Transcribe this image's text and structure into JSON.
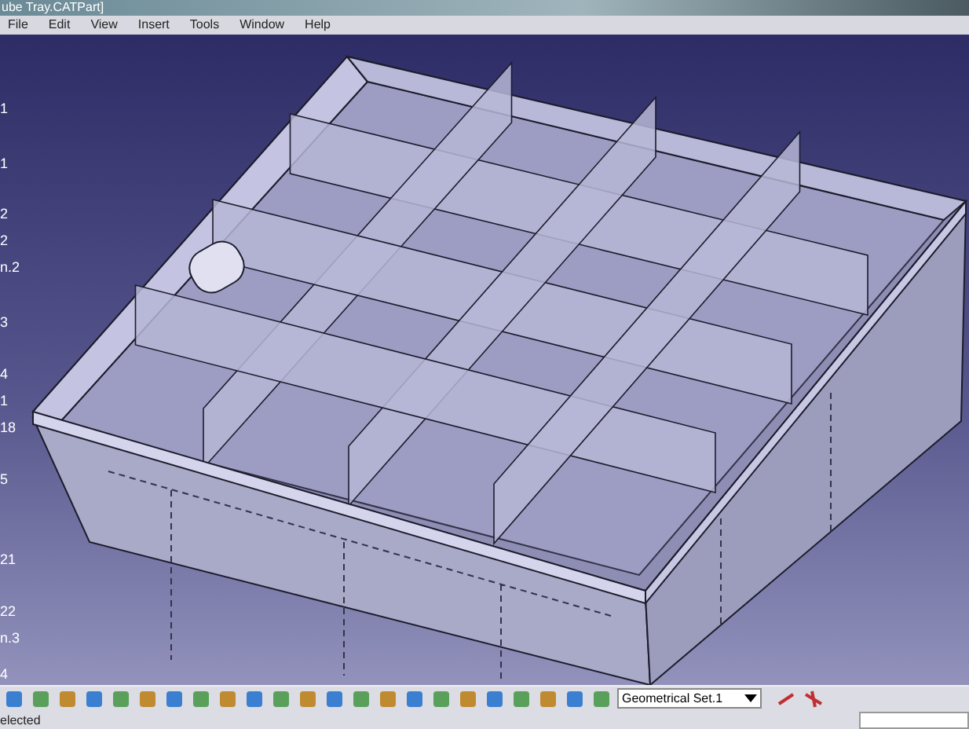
{
  "window": {
    "title": "ube Tray.CATPart]"
  },
  "menu": [
    "File",
    "Edit",
    "View",
    "Insert",
    "Tools",
    "Window",
    "Help"
  ],
  "tree_labels": [
    "1",
    "1",
    "2",
    "2",
    "n.2",
    "3",
    "4",
    "1",
    "18",
    "5",
    "21",
    "22",
    "n.3",
    "4"
  ],
  "toolbar": {
    "geometrical_set": "Geometrical Set.1"
  },
  "status_bar": {
    "message": "elected"
  }
}
